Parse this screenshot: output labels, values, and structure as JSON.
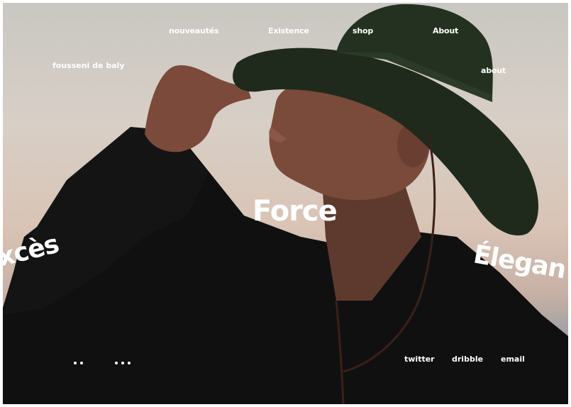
{
  "brand": "fousseni de baly",
  "nav": {
    "items": [
      "nouveautés",
      "Existence",
      "shop",
      "About"
    ],
    "secondary": "about"
  },
  "hero": {
    "center": "Force",
    "left": "xcès",
    "right": "Élegan"
  },
  "social": [
    "twitter",
    "dribble",
    "email"
  ],
  "carousel": {
    "group_a_dots": 2,
    "group_b_dots": 3
  },
  "colors": {
    "text": "#ffffff",
    "hat": "#1f2a1c",
    "shirt": "#0f0f0f",
    "skin": "#7a4a3a"
  }
}
